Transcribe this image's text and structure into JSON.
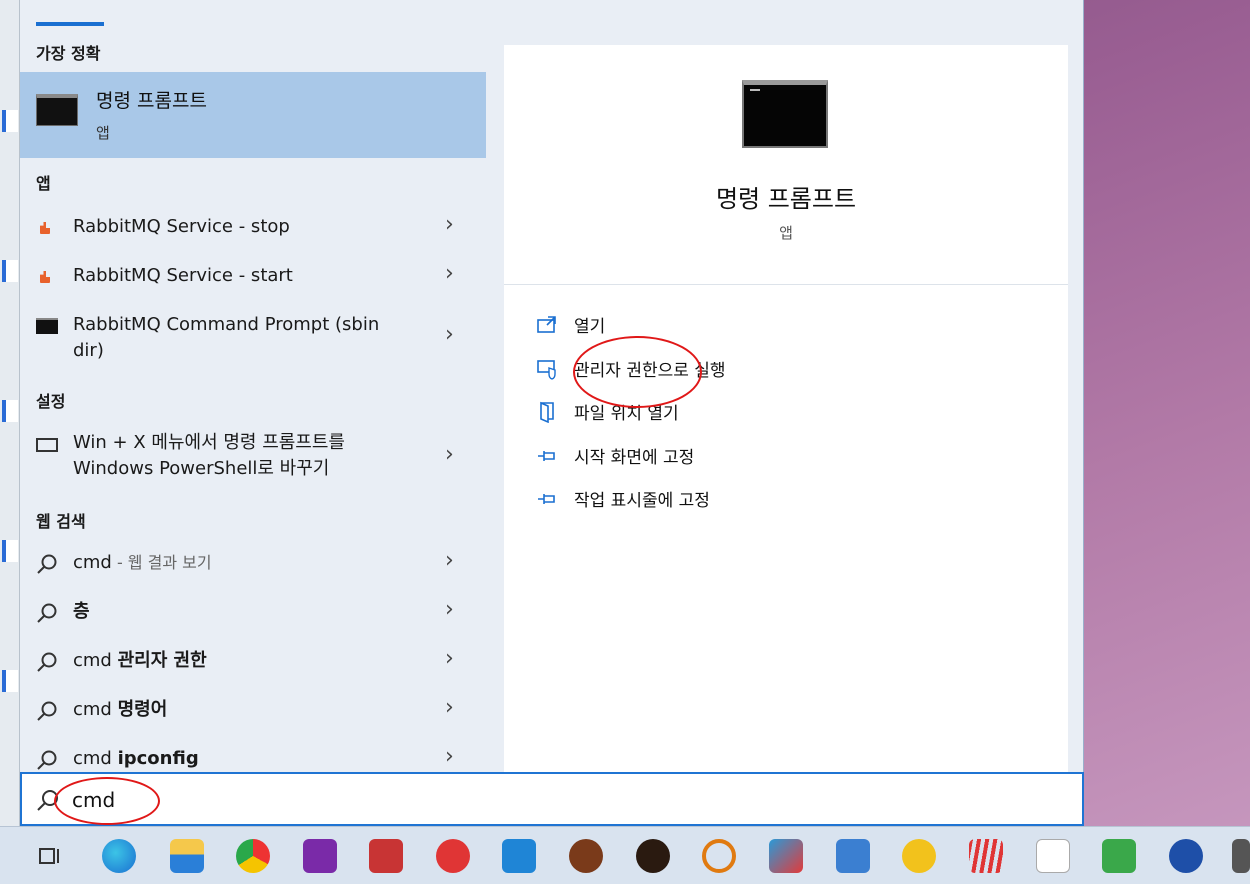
{
  "search": {
    "value": "cmd",
    "placeholder": ""
  },
  "best_match": {
    "header": "가장 정확",
    "title": "명령 프롬프트",
    "subtitle": "앱"
  },
  "apps": {
    "header": "앱",
    "items": [
      {
        "label": "RabbitMQ Service - stop",
        "icon": "rabbitmq-icon"
      },
      {
        "label": "RabbitMQ Service - start",
        "icon": "rabbitmq-icon"
      },
      {
        "label": "RabbitMQ Command Prompt (sbin dir)",
        "icon": "command-prompt-icon"
      }
    ]
  },
  "settings": {
    "header": "설정",
    "items": [
      {
        "label": "Win + X 메뉴에서 명령 프롬프트를 Windows PowerShell로 바꾸기",
        "icon": "monitor-icon"
      }
    ]
  },
  "web_search": {
    "header": "웹 검색",
    "items": [
      {
        "prefix": "cmd",
        "suffix": " - 웹 결과 보기",
        "bold": ""
      },
      {
        "prefix": "",
        "suffix": "",
        "bold": "층"
      },
      {
        "prefix": "cmd ",
        "suffix": "",
        "bold": "관리자 권한"
      },
      {
        "prefix": "cmd ",
        "suffix": "",
        "bold": "명령어"
      },
      {
        "prefix": "cmd ",
        "suffix": "",
        "bold": "ipconfig"
      }
    ]
  },
  "detail": {
    "title": "명령 프롬프트",
    "subtitle": "앱",
    "actions": [
      {
        "label": "열기",
        "icon": "open-icon"
      },
      {
        "label": "관리자 권한으로 실행",
        "icon": "shield-icon"
      },
      {
        "label": "파일 위치 열기",
        "icon": "folder-icon"
      },
      {
        "label": "시작 화면에 고정",
        "icon": "pin-icon"
      },
      {
        "label": "작업 표시줄에 고정",
        "icon": "pin-icon"
      }
    ]
  },
  "taskbar": {
    "icons": [
      "task-view-icon",
      "edge-icon",
      "file-explorer-icon",
      "chrome-icon",
      "onenote-icon",
      "app-red-icon",
      "app-red2-icon",
      "vscode-icon",
      "app-spark-icon",
      "app-dark-icon",
      "search-magnifier-icon",
      "app-bird-icon",
      "hangul-icon",
      "wave-icon",
      "app-stripes-icon",
      "document-icon",
      "notepad-icon",
      "word-icon",
      "app-last-icon"
    ]
  },
  "colors": {
    "accent": "#1a6fd1",
    "selected": "#a9c8e8",
    "annotation": "#e01818"
  }
}
